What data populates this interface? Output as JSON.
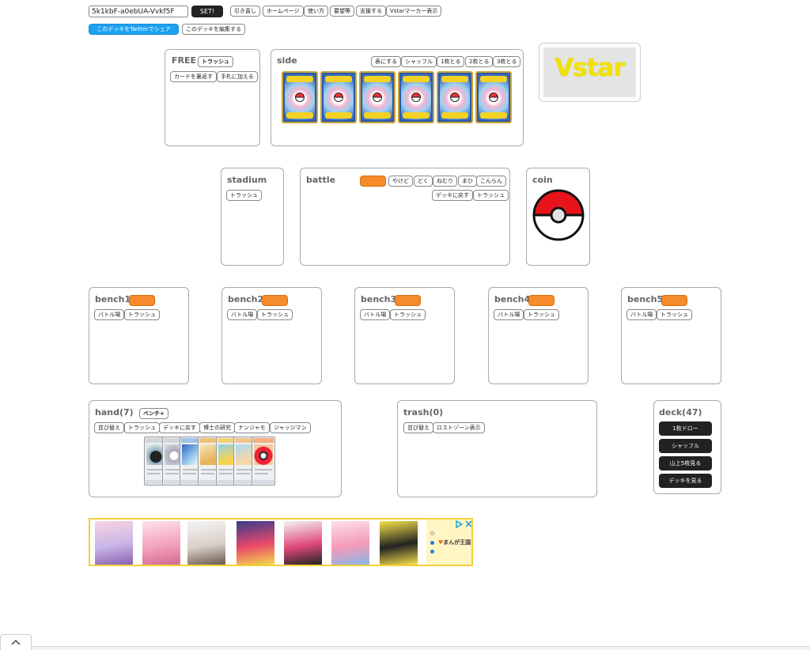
{
  "header": {
    "deck_code": "5k1kbF-a0ebUA-Vvkf5F",
    "set_button": "SET!",
    "nav": [
      "引き直し",
      "ホームページ",
      "使い方",
      "要望等",
      "支援する",
      "Vstarマーカー表示"
    ],
    "share_twitter": "このデッキをTwitterでシェア",
    "edit_deck": "このデッキを編集する"
  },
  "free": {
    "title": "FREE",
    "trash": "トラッシュ",
    "flip": "カードを裏返す",
    "to_hand": "手札に加える"
  },
  "side": {
    "title": "side",
    "buttons": [
      "表にする",
      "シャッフル",
      "1枚とる",
      "2枚とる",
      "3枚とる"
    ],
    "card_count": 6
  },
  "vstar": {
    "label": "Vstar",
    "color": "#f2e200"
  },
  "stadium": {
    "title": "stadium",
    "trash": "トラッシュ"
  },
  "battle": {
    "title": "battle",
    "conditions": [
      "やけど",
      "どく",
      "ねむり",
      "まひ",
      "こんらん"
    ],
    "return_deck": "デッキに戻す",
    "trash": "トラッシュ"
  },
  "coin": {
    "title": "coin"
  },
  "benches": [
    {
      "title": "bench1",
      "to_battle": "バトル場",
      "trash": "トラッシュ"
    },
    {
      "title": "bench2",
      "to_battle": "バトル場",
      "trash": "トラッシュ"
    },
    {
      "title": "bench3",
      "to_battle": "バトル場",
      "trash": "トラッシュ"
    },
    {
      "title": "bench4",
      "to_battle": "バトル場",
      "trash": "トラッシュ"
    },
    {
      "title": "bench5",
      "to_battle": "バトル場",
      "trash": "トラッシュ"
    }
  ],
  "hand": {
    "title": "hand(7)",
    "bench_plus": "ベンチ+",
    "buttons": [
      "並び替え",
      "トラッシュ",
      "デッキに戻す",
      "博士の研究",
      "ナンジャモ",
      "ジャッジマン"
    ]
  },
  "trash": {
    "title": "trash(0)",
    "buttons": [
      "並び替え",
      "ロストゾーン表示"
    ]
  },
  "deck": {
    "title": "deck(47)",
    "buttons": [
      "1枚ドロー",
      "シャッフル",
      "山上5枚見る",
      "デッキを見る"
    ]
  },
  "ad": {
    "brand": "まんが王国"
  },
  "colors": {
    "accent_orange": "#f68b2c",
    "twitter_blue": "#1da1f2",
    "dark_button": "#222222"
  }
}
